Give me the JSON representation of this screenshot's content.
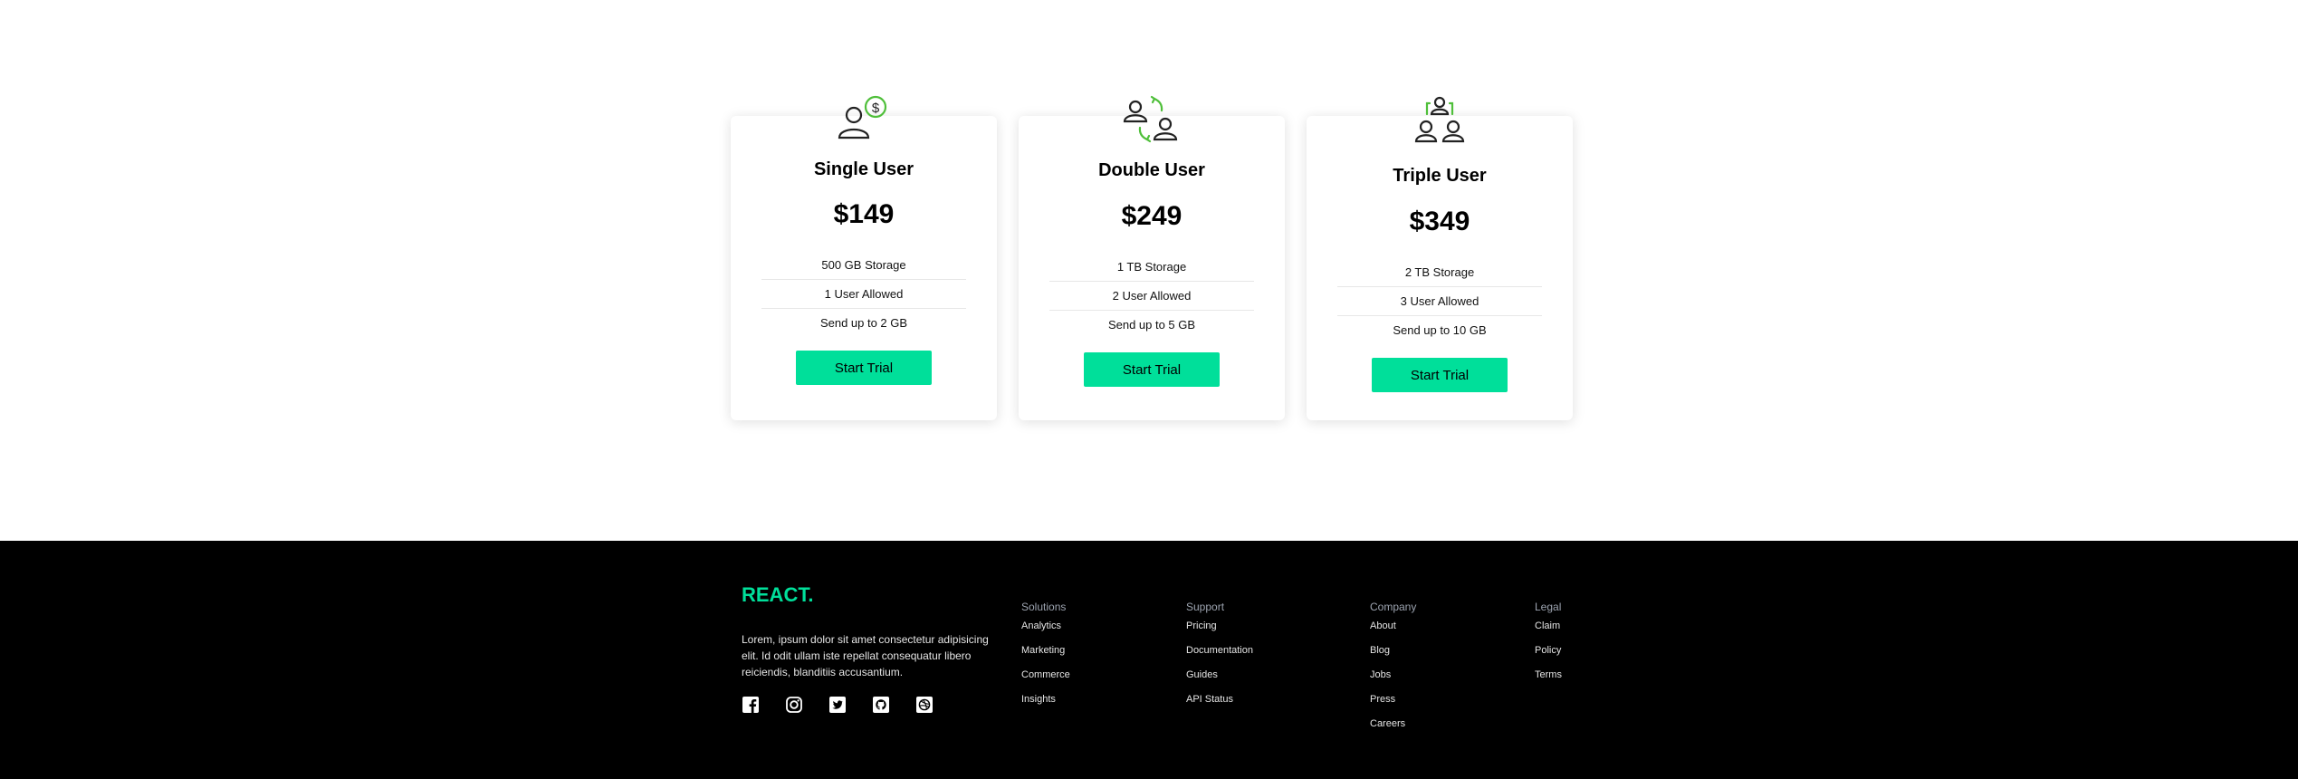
{
  "plans": [
    {
      "icon": "single-user-dollar-icon",
      "title": "Single User",
      "price": "$149",
      "features": [
        "500 GB Storage",
        "1 User Allowed",
        "Send up to 2 GB"
      ],
      "button": "Start Trial"
    },
    {
      "icon": "double-user-exchange-icon",
      "title": "Double User",
      "price": "$249",
      "features": [
        "1 TB Storage",
        "2 User Allowed",
        "Send up to 5 GB"
      ],
      "button": "Start Trial"
    },
    {
      "icon": "triple-user-group-icon",
      "title": "Triple User",
      "price": "$349",
      "features": [
        "2 TB Storage",
        "3 User Allowed",
        "Send up to 10 GB"
      ],
      "button": "Start Trial"
    }
  ],
  "footer": {
    "brand": "REACT.",
    "description": "Lorem, ipsum dolor sit amet consectetur adipisicing elit. Id odit ullam iste repellat consequatur libero reiciendis, blanditiis accusantium.",
    "socials": [
      "facebook-icon",
      "instagram-icon",
      "twitter-icon",
      "github-icon",
      "dribbble-icon"
    ],
    "columns": [
      {
        "title": "Solutions",
        "links": [
          "Analytics",
          "Marketing",
          "Commerce",
          "Insights"
        ]
      },
      {
        "title": "Support",
        "links": [
          "Pricing",
          "Documentation",
          "Guides",
          "API Status"
        ]
      },
      {
        "title": "Company",
        "links": [
          "About",
          "Blog",
          "Jobs",
          "Press",
          "Careers"
        ]
      },
      {
        "title": "Legal",
        "links": [
          "Claim",
          "Policy",
          "Terms"
        ]
      }
    ]
  },
  "colors": {
    "accent": "#00df9a",
    "icon_accent": "#4fbf3a",
    "footer_bg": "#000000"
  }
}
